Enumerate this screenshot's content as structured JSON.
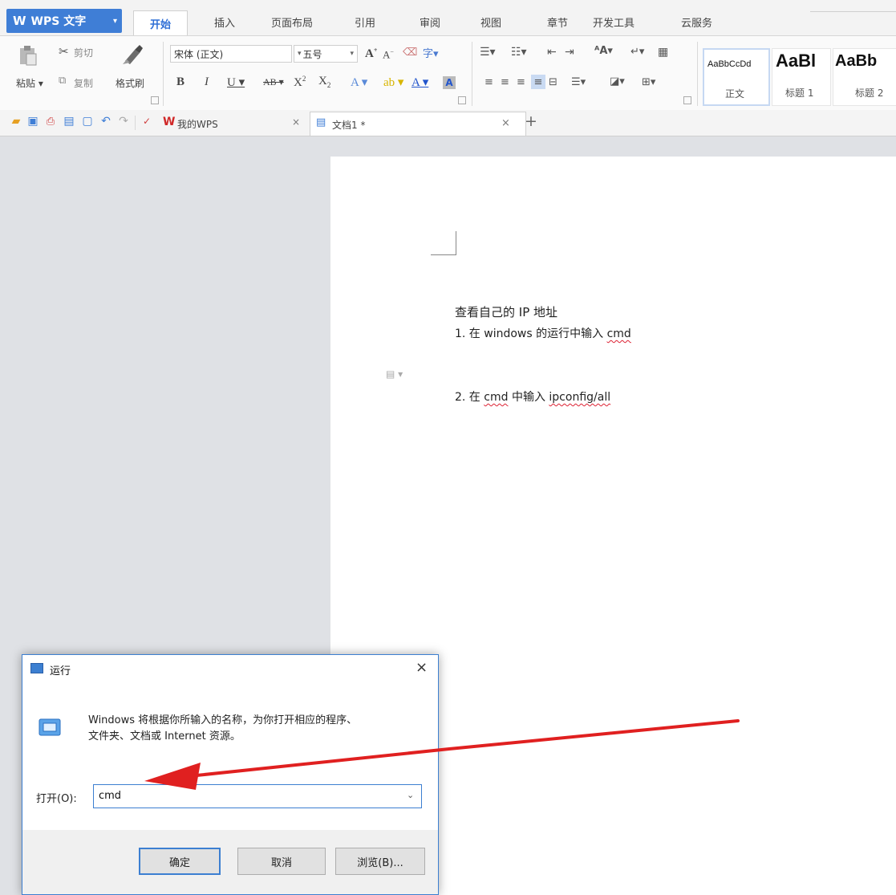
{
  "app": {
    "title": "WPS 文字",
    "logo_glyph": "W"
  },
  "menu": {
    "tabs": [
      {
        "label": "开始",
        "active": true
      },
      {
        "label": "插入"
      },
      {
        "label": "页面布局"
      },
      {
        "label": "引用"
      },
      {
        "label": "审阅"
      },
      {
        "label": "视图"
      },
      {
        "label": "章节"
      },
      {
        "label": "开发工具"
      },
      {
        "label": "云服务"
      }
    ]
  },
  "ribbon": {
    "paste_label": "粘贴",
    "cut_label": "剪切",
    "copy_label": "复制",
    "format_painter_label": "格式刷",
    "font_name": "宋体 (正文)",
    "font_size": "五号",
    "styles": [
      {
        "sample": "AaBbCcDd",
        "name": "正文"
      },
      {
        "sample": "AaBl",
        "name": "标题 1"
      },
      {
        "sample": "AaBb",
        "name": "标题 2"
      }
    ]
  },
  "doc_tabs": {
    "home_tab_label": "我的WPS",
    "doc_tab_label": "文档1 *"
  },
  "document": {
    "heading": "查看自己的 IP 地址",
    "step1_prefix": "1. 在 windows 的运行中输入 ",
    "step1_cmd": "cmd",
    "step2_prefix": "2. 在 ",
    "step2_cmd": "cmd",
    "step2_mid": " 中输入 ",
    "step2_arg": "ipconfig/all"
  },
  "run_dialog": {
    "title": "运行",
    "description_line1": "Windows 将根据你所输入的名称，为你打开相应的程序、",
    "description_line2": "文件夹、文档或 Internet 资源。",
    "open_label": "打开(O):",
    "open_value": "cmd",
    "ok_label": "确定",
    "cancel_label": "取消",
    "browse_label": "浏览(B)..."
  },
  "colors": {
    "accent": "#3f7ed6",
    "annotation_arrow": "#e02020"
  }
}
